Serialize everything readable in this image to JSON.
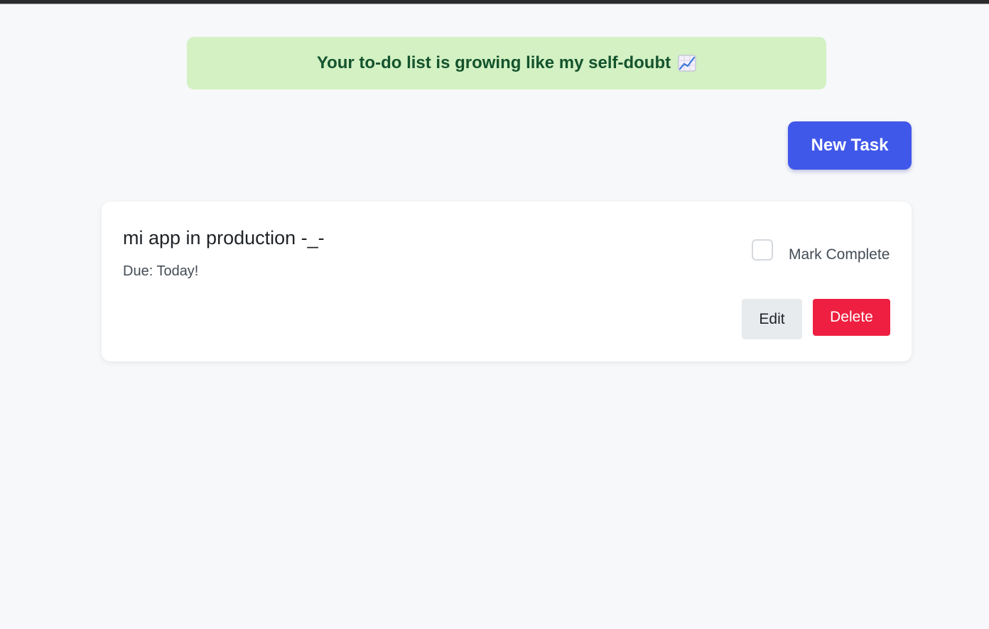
{
  "banner": {
    "text": "Your to-do list is growing like my self-doubt",
    "icon": "chart-increasing-icon"
  },
  "toolbar": {
    "new_task_label": "New Task"
  },
  "tasks": [
    {
      "title": "mi app in production -_-",
      "due": "Due: Today!",
      "complete_label": "Mark Complete",
      "completed": false,
      "edit_label": "Edit",
      "delete_label": "Delete"
    }
  ],
  "colors": {
    "banner_bg": "#d3f1c3",
    "banner_text": "#14532d",
    "primary": "#4058ea",
    "danger": "#ee1f40",
    "neutral_button": "#e8ebee",
    "page_bg": "#f7f8fa"
  }
}
